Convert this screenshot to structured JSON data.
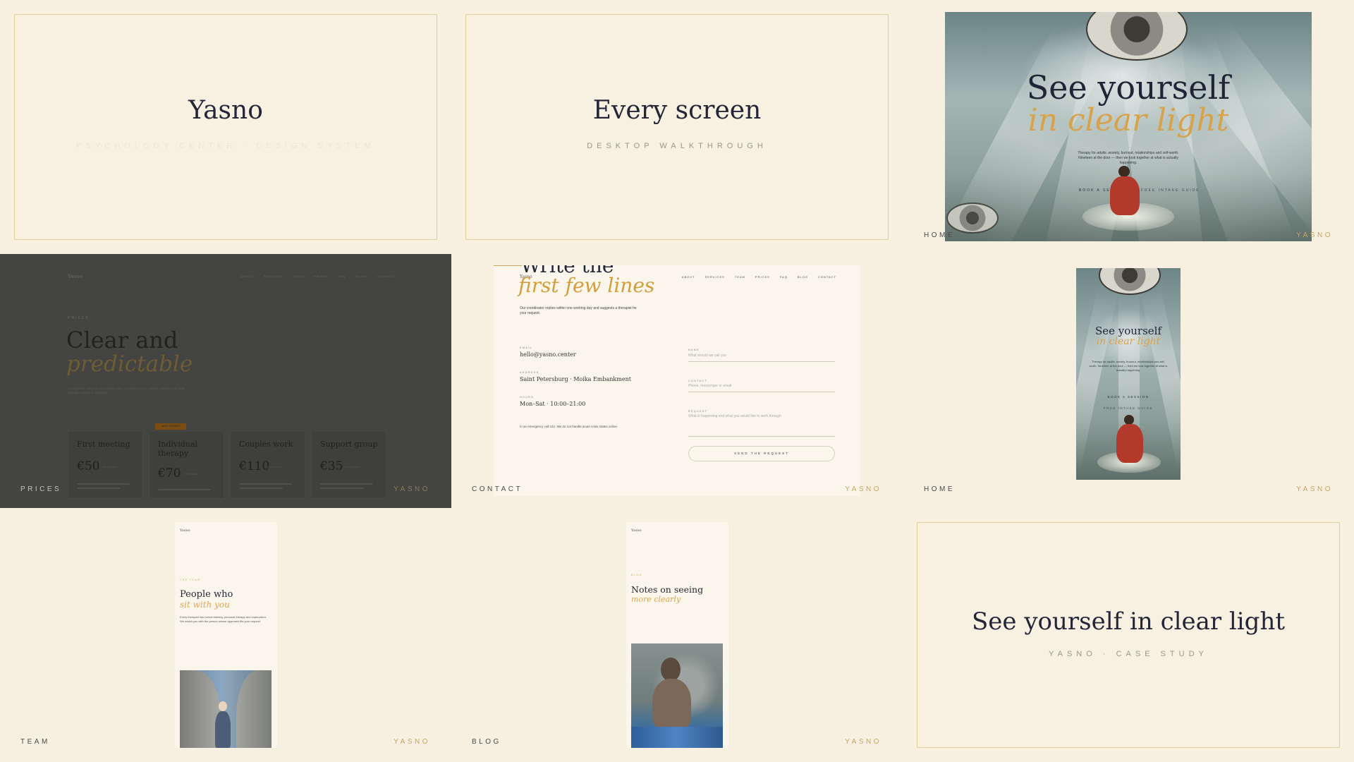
{
  "colors": {
    "background": "#f7f0e1",
    "frame": "#e2cd9d",
    "accent_gold": "#c9a45c",
    "ink": "#232637",
    "dark_panel": "#444442"
  },
  "tiles": {
    "intro": {
      "title": "Yasno",
      "subtitle": "PSYCHOLOGY CENTER · DESIGN SYSTEM"
    },
    "walkthrough": {
      "title": "Every screen",
      "subtitle": "DESKTOP WALKTHROUGH"
    },
    "home_desktop": {
      "headline_1": "See yourself",
      "headline_2": "in clear light",
      "body": "Therapy for adults: anxiety, burnout, relationships and self-worth. Nineteen at the door — then we look together at what is actually happening.",
      "cta_primary": "BOOK A SESSION",
      "cta_secondary": "FREE INTAKE GUIDE",
      "label": "HOME",
      "brand": "YASNO"
    },
    "prices": {
      "logo": "Yasno",
      "nav": [
        "ABOUT",
        "SERVICES",
        "TEAM",
        "PRICES",
        "FAQ",
        "BLOG",
        "CONTACT"
      ],
      "eyebrow": "PRICES",
      "headline_1": "Clear and",
      "headline_2": "predictable",
      "body": "Transparent rates with no surprise fees; sessions are 50 minutes. Sliding scale and package discounts available.",
      "badge": "MOST CHOSEN",
      "cards": [
        {
          "name": "First meeting",
          "price": "€50",
          "unit": "per session"
        },
        {
          "name": "Individual therapy",
          "price": "€70",
          "unit": "per session"
        },
        {
          "name": "Couples work",
          "price": "€110",
          "unit": "per session"
        },
        {
          "name": "Support group",
          "price": "€35",
          "unit": "per session"
        }
      ],
      "label": "PRICES",
      "brand": "YASNO"
    },
    "contact": {
      "logo": "Yasno",
      "nav": [
        "ABOUT",
        "SERVICES",
        "TEAM",
        "PRICES",
        "FAQ",
        "BLOG",
        "CONTACT"
      ],
      "headline_1": "Write the",
      "headline_2": "first few lines",
      "lead": "Our coordinator replies within one working day and suggests a therapist for your request.",
      "email_label": "EMAIL",
      "email": "hello@yasno.center",
      "address_label": "ADDRESS",
      "address": "Saint Petersburg · Moika Embankment",
      "hours_label": "HOURS",
      "hours": "Mon–Sat · 10:00–21:00",
      "emergency": "In an emergency call 112. We do not handle acute crisis states online.",
      "name_label": "NAME",
      "name_placeholder": "What should we call you",
      "contact_label": "CONTACT",
      "contact_placeholder": "Phone, messenger or email",
      "request_label": "REQUEST",
      "request_placeholder": "What is happening and what you would like to work through",
      "submit": "SEND THE REQUEST",
      "label": "CONTACT",
      "brand": "YASNO"
    },
    "home_mobile": {
      "headline_1": "See yourself",
      "headline_2": "in clear light",
      "body": "Therapy for adults: anxiety, burnout, relationships and self-worth. Nineteen at the door — then we look together at what is actually happening.",
      "cta_primary": "BOOK A SESSION",
      "cta_secondary": "FREE INTAKE GUIDE",
      "label": "HOME",
      "brand": "YASNO"
    },
    "team_mobile": {
      "logo": "Yasno",
      "eyebrow": "THE TEAM",
      "headline_1": "People who",
      "headline_2": "sit with you",
      "body": "Every therapist has formal training, personal therapy and supervision. We match you with the person whose approach fits your request.",
      "label": "TEAM",
      "brand": "YASNO"
    },
    "blog_mobile": {
      "logo": "Yasno",
      "eyebrow": "BLOG",
      "headline_1": "Notes on seeing",
      "headline_2": "more clearly",
      "label": "BLOG",
      "brand": "YASNO"
    },
    "outro": {
      "title": "See yourself in clear light",
      "subtitle": "YASNO · CASE STUDY"
    }
  }
}
